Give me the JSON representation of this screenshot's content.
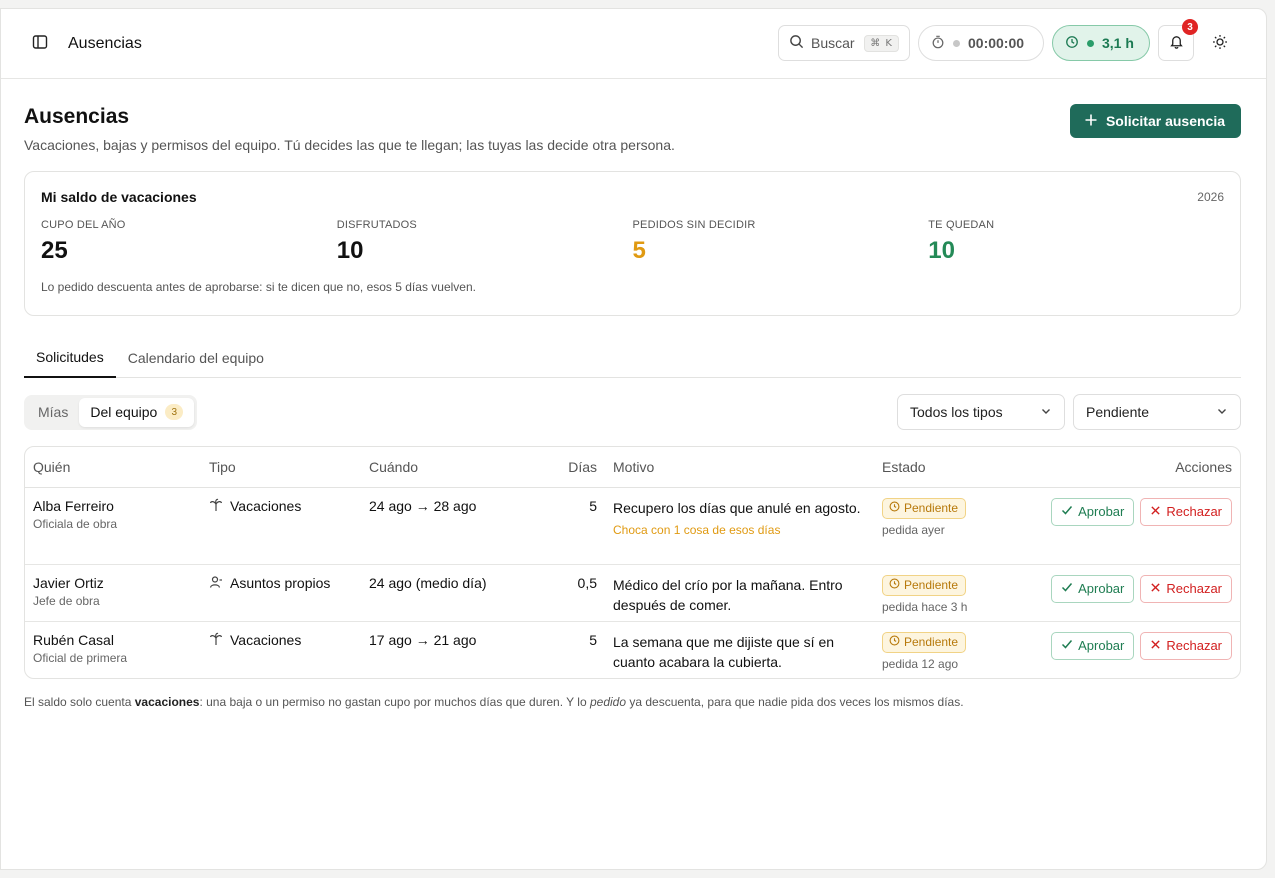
{
  "topbar": {
    "title": "Ausencias",
    "search_label": "Buscar",
    "search_shortcut": "⌘ K",
    "timer_value": "00:00:00",
    "hours_value": "3,1 h",
    "notifications_count": "3"
  },
  "header": {
    "title": "Ausencias",
    "subtitle": "Vacaciones, bajas y permisos del equipo. Tú decides las que te llegan; las tuyas las decide otra persona.",
    "request_button": "Solicitar ausencia"
  },
  "balance": {
    "title": "Mi saldo de vacaciones",
    "year": "2026",
    "stats": [
      {
        "label": "CUPO DEL AÑO",
        "value": "25"
      },
      {
        "label": "DISFRUTADOS",
        "value": "10"
      },
      {
        "label": "PEDIDOS SIN DECIDIR",
        "value": "5"
      },
      {
        "label": "TE QUEDAN",
        "value": "10"
      }
    ],
    "note": "Lo pedido descuenta antes de aprobarse: si te dicen que no, esos 5 días vuelven."
  },
  "tabs": [
    "Solicitudes",
    "Calendario del equipo"
  ],
  "filters": {
    "segment_mine": "Mías",
    "segment_team": "Del equipo",
    "segment_team_count": "3",
    "type_select": "Todos los tipos",
    "state_select": "Pendiente"
  },
  "table": {
    "columns": [
      "Quién",
      "Tipo",
      "Cuándo",
      "Días",
      "Motivo",
      "Estado",
      "Acciones"
    ],
    "approve_label": "Aprobar",
    "reject_label": "Rechazar",
    "rows": [
      {
        "name": "Alba Ferreiro",
        "role": "Oficiala de obra",
        "type": "Vacaciones",
        "type_icon": "palm-tree-icon",
        "when": "24 ago → 28 ago",
        "days": "5",
        "reason": "Recupero los días que anulé en agosto.",
        "conflict": "Choca con 1 cosa de esos días",
        "status": "Pendiente",
        "requested": "pedida ayer"
      },
      {
        "name": "Javier Ortiz",
        "role": "Jefe de obra",
        "type": "Asuntos propios",
        "type_icon": "user-icon",
        "when": "24 ago (medio día)",
        "days": "0,5",
        "reason": "Médico del crío por la mañana. Entro después de comer.",
        "conflict": "",
        "status": "Pendiente",
        "requested": "pedida hace 3 h"
      },
      {
        "name": "Rubén Casal",
        "role": "Oficial de primera",
        "type": "Vacaciones",
        "type_icon": "palm-tree-icon",
        "when": "17 ago → 21 ago",
        "days": "5",
        "reason": "La semana que me dijiste que sí en cuanto acabara la cubierta.",
        "conflict": "",
        "status": "Pendiente",
        "requested": "pedida 12 ago"
      }
    ]
  },
  "footnote": {
    "part1": "El saldo solo cuenta ",
    "bold": "vacaciones",
    "part2": ": una baja o un permiso no gastan cupo por muchos días que duren. Y lo ",
    "italic": "pedido",
    "part3": " ya descuenta, para que nadie pida dos veces los mismos días."
  },
  "colors": {
    "primary": "#1f6b5a",
    "pending": "#e09a12",
    "remaining": "#248a57",
    "reject": "#d21f1f",
    "badge": "#e02424"
  }
}
